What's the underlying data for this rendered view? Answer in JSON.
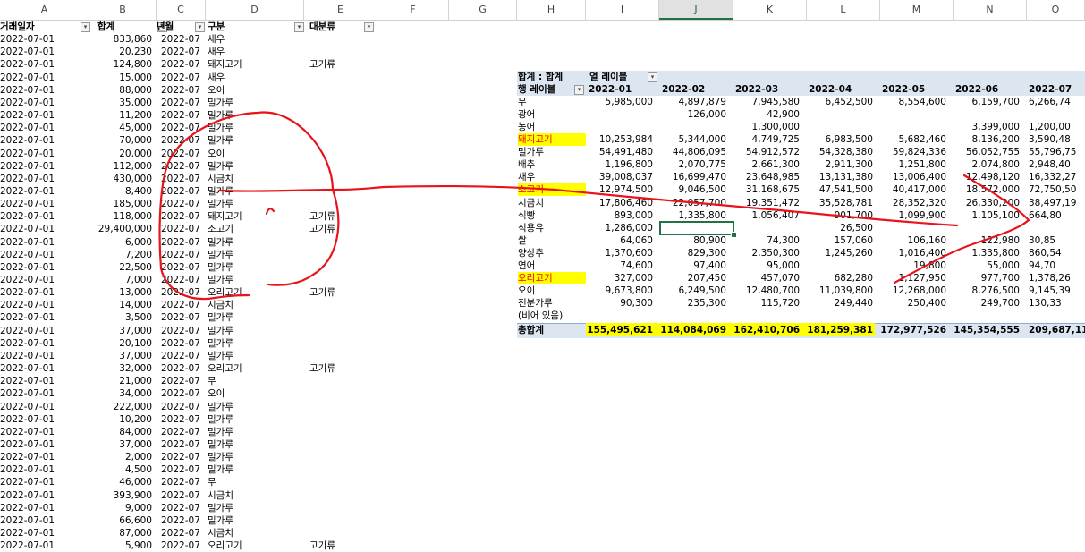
{
  "columns": [
    "A",
    "B",
    "C",
    "D",
    "E",
    "F",
    "G",
    "H",
    "I",
    "J",
    "K",
    "L",
    "M",
    "N",
    "O"
  ],
  "selected_column": "J",
  "source_headers": {
    "date": "거래일자",
    "total": "합계",
    "ym": "년월",
    "category": "구분",
    "major": "대분류"
  },
  "source_rows": [
    [
      "2022-07-01",
      "833,860",
      "2022-07",
      "새우",
      ""
    ],
    [
      "2022-07-01",
      "20,230",
      "2022-07",
      "새우",
      ""
    ],
    [
      "2022-07-01",
      "124,800",
      "2022-07",
      "돼지고기",
      "고기류"
    ],
    [
      "2022-07-01",
      "15,000",
      "2022-07",
      "새우",
      ""
    ],
    [
      "2022-07-01",
      "88,000",
      "2022-07",
      "오이",
      ""
    ],
    [
      "2022-07-01",
      "35,000",
      "2022-07",
      "밀가루",
      ""
    ],
    [
      "2022-07-01",
      "11,200",
      "2022-07",
      "밀가루",
      ""
    ],
    [
      "2022-07-01",
      "45,000",
      "2022-07",
      "밀가루",
      ""
    ],
    [
      "2022-07-01",
      "70,000",
      "2022-07",
      "밀가루",
      ""
    ],
    [
      "2022-07-01",
      "20,000",
      "2022-07",
      "오이",
      ""
    ],
    [
      "2022-07-01",
      "112,000",
      "2022-07",
      "밀가루",
      ""
    ],
    [
      "2022-07-01",
      "430,000",
      "2022-07",
      "시금치",
      ""
    ],
    [
      "2022-07-01",
      "8,400",
      "2022-07",
      "밀가루",
      ""
    ],
    [
      "2022-07-01",
      "185,000",
      "2022-07",
      "밀가루",
      ""
    ],
    [
      "2022-07-01",
      "118,000",
      "2022-07",
      "돼지고기",
      "고기류"
    ],
    [
      "2022-07-01",
      "29,400,000",
      "2022-07",
      "소고기",
      "고기류"
    ],
    [
      "2022-07-01",
      "6,000",
      "2022-07",
      "밀가루",
      ""
    ],
    [
      "2022-07-01",
      "7,200",
      "2022-07",
      "밀가루",
      ""
    ],
    [
      "2022-07-01",
      "22,500",
      "2022-07",
      "밀가루",
      ""
    ],
    [
      "2022-07-01",
      "7,000",
      "2022-07",
      "밀가루",
      ""
    ],
    [
      "2022-07-01",
      "13,000",
      "2022-07",
      "오리고기",
      "고기류"
    ],
    [
      "2022-07-01",
      "14,000",
      "2022-07",
      "시금치",
      ""
    ],
    [
      "2022-07-01",
      "3,500",
      "2022-07",
      "밀가루",
      ""
    ],
    [
      "2022-07-01",
      "37,000",
      "2022-07",
      "밀가루",
      ""
    ],
    [
      "2022-07-01",
      "20,100",
      "2022-07",
      "밀가루",
      ""
    ],
    [
      "2022-07-01",
      "37,000",
      "2022-07",
      "밀가루",
      ""
    ],
    [
      "2022-07-01",
      "32,000",
      "2022-07",
      "오리고기",
      "고기류"
    ],
    [
      "2022-07-01",
      "21,000",
      "2022-07",
      "무",
      ""
    ],
    [
      "2022-07-01",
      "34,000",
      "2022-07",
      "오이",
      ""
    ],
    [
      "2022-07-01",
      "222,000",
      "2022-07",
      "밀가루",
      ""
    ],
    [
      "2022-07-01",
      "10,200",
      "2022-07",
      "밀가루",
      ""
    ],
    [
      "2022-07-01",
      "84,000",
      "2022-07",
      "밀가루",
      ""
    ],
    [
      "2022-07-01",
      "37,000",
      "2022-07",
      "밀가루",
      ""
    ],
    [
      "2022-07-01",
      "2,000",
      "2022-07",
      "밀가루",
      ""
    ],
    [
      "2022-07-01",
      "4,500",
      "2022-07",
      "밀가루",
      ""
    ],
    [
      "2022-07-01",
      "46,000",
      "2022-07",
      "무",
      ""
    ],
    [
      "2022-07-01",
      "393,900",
      "2022-07",
      "시금치",
      ""
    ],
    [
      "2022-07-01",
      "9,000",
      "2022-07",
      "밀가루",
      ""
    ],
    [
      "2022-07-01",
      "66,600",
      "2022-07",
      "밀가루",
      ""
    ],
    [
      "2022-07-01",
      "87,000",
      "2022-07",
      "시금치",
      ""
    ],
    [
      "2022-07-01",
      "5,900",
      "2022-07",
      "오리고기",
      "고기류"
    ]
  ],
  "pivot": {
    "title": "합계 : 합계",
    "col_label": "열 레이블",
    "row_label": "행 레이블",
    "months": [
      "2022-01",
      "2022-02",
      "2022-03",
      "2022-04",
      "2022-05",
      "2022-06",
      "2022-07"
    ],
    "rows": [
      {
        "name": "무",
        "highlight": false,
        "vals": [
          "5,985,000",
          "4,897,879",
          "7,945,580",
          "6,452,500",
          "8,554,600",
          "6,159,700",
          "6,266,74"
        ]
      },
      {
        "name": "광어",
        "highlight": false,
        "vals": [
          "",
          "126,000",
          "42,900",
          "",
          "",
          "",
          ""
        ]
      },
      {
        "name": "농어",
        "highlight": false,
        "vals": [
          "",
          "",
          "1,300,000",
          "",
          "",
          "3,399,000",
          "1,200,00"
        ]
      },
      {
        "name": "돼지고기",
        "highlight": true,
        "vals": [
          "10,253,984",
          "5,344,000",
          "4,749,725",
          "6,983,500",
          "5,682,460",
          "8,136,200",
          "3,590,48"
        ]
      },
      {
        "name": "밀가루",
        "highlight": false,
        "vals": [
          "54,491,480",
          "44,806,095",
          "54,912,572",
          "54,328,380",
          "59,824,336",
          "56,052,755",
          "55,796,75"
        ]
      },
      {
        "name": "배추",
        "highlight": false,
        "vals": [
          "1,196,800",
          "2,070,775",
          "2,661,300",
          "2,911,300",
          "1,251,800",
          "2,074,800",
          "2,948,40"
        ]
      },
      {
        "name": "새우",
        "highlight": false,
        "vals": [
          "39,008,037",
          "16,699,470",
          "23,648,985",
          "13,131,380",
          "13,006,400",
          "12,498,120",
          "16,332,27"
        ]
      },
      {
        "name": "소고기",
        "highlight": true,
        "vals": [
          "12,974,500",
          "9,046,500",
          "31,168,675",
          "47,541,500",
          "40,417,000",
          "18,572,000",
          "72,750,50"
        ]
      },
      {
        "name": "시금치",
        "highlight": false,
        "vals": [
          "17,806,460",
          "22,057,700",
          "19,351,472",
          "35,528,781",
          "28,352,320",
          "26,330,200",
          "38,497,19"
        ]
      },
      {
        "name": "식빵",
        "highlight": false,
        "vals": [
          "893,000",
          "1,335,800",
          "1,056,407",
          "901,700",
          "1,099,900",
          "1,105,100",
          "664,80"
        ]
      },
      {
        "name": "식용유",
        "highlight": false,
        "vals": [
          "1,286,000",
          "",
          "",
          "26,500",
          "",
          "",
          ""
        ]
      },
      {
        "name": "쌀",
        "highlight": false,
        "vals": [
          "64,060",
          "80,900",
          "74,300",
          "157,060",
          "106,160",
          "122,980",
          "30,85"
        ]
      },
      {
        "name": "양상추",
        "highlight": false,
        "vals": [
          "1,370,600",
          "829,300",
          "2,350,300",
          "1,245,260",
          "1,016,400",
          "1,335,800",
          "860,54"
        ]
      },
      {
        "name": "연어",
        "highlight": false,
        "vals": [
          "74,600",
          "97,400",
          "95,000",
          "",
          "19,800",
          "55,000",
          "94,70"
        ]
      },
      {
        "name": "오리고기",
        "highlight": true,
        "vals": [
          "327,000",
          "207,450",
          "457,070",
          "682,280",
          "1,127,950",
          "977,700",
          "1,378,26"
        ]
      },
      {
        "name": "오이",
        "highlight": false,
        "vals": [
          "9,673,800",
          "6,249,500",
          "12,480,700",
          "11,039,800",
          "12,268,000",
          "8,276,500",
          "9,145,39"
        ]
      },
      {
        "name": "전분가루",
        "highlight": false,
        "vals": [
          "90,300",
          "235,300",
          "115,720",
          "249,440",
          "250,400",
          "249,700",
          "130,33"
        ]
      },
      {
        "name": "(비어 있음)",
        "highlight": false,
        "vals": [
          "",
          "",
          "",
          "",
          "",
          "",
          ""
        ]
      }
    ],
    "total_label": "총합계",
    "totals": [
      "155,495,621",
      "114,084,069",
      "162,410,706",
      "181,259,381",
      "172,977,526",
      "145,354,555",
      "209,687,11"
    ],
    "totals_highlight": [
      true,
      true,
      true,
      true,
      false,
      false,
      false
    ]
  },
  "colors": {
    "highlight": "#ffff00",
    "highlight_text": "#ff0000",
    "pivot_band": "#dce6f1",
    "ink": "#e8141b",
    "selection": "#217346"
  }
}
